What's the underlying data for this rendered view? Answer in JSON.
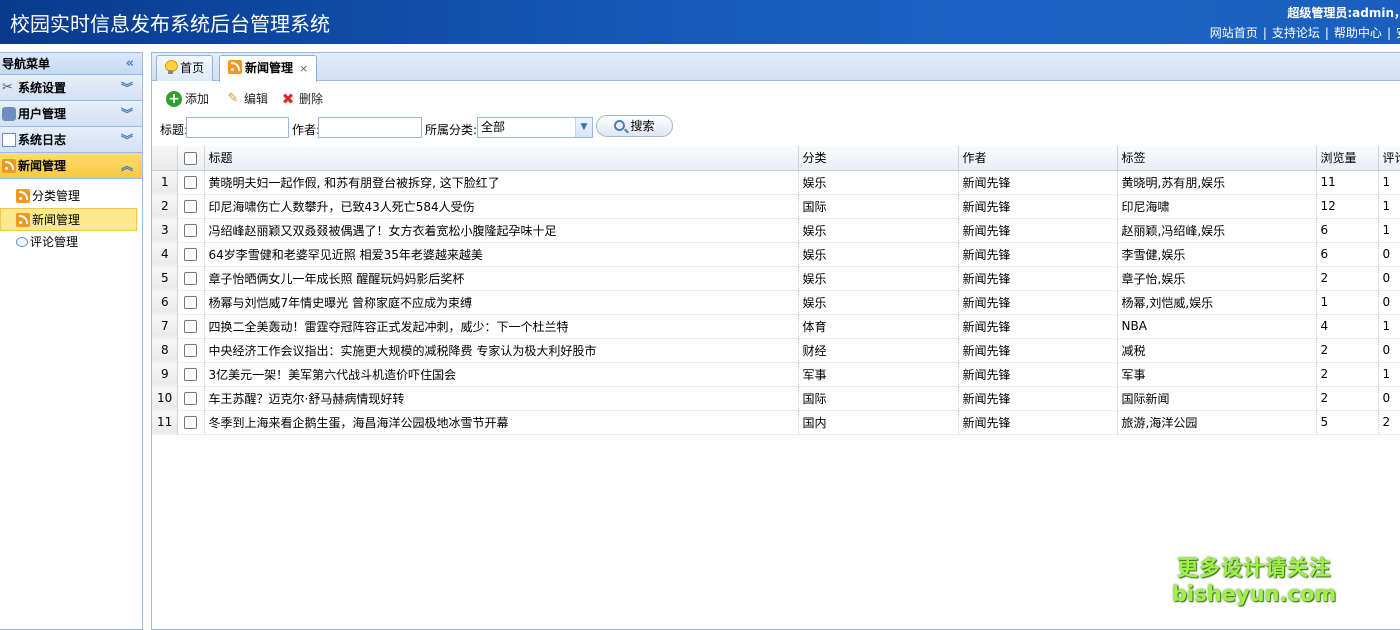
{
  "header": {
    "title": "校园实时信息发布系统后台管理系统",
    "user_text": "超级管理员:admin，",
    "links": [
      "网站首页",
      "支持论坛",
      "帮助中心",
      "安"
    ]
  },
  "sidebar": {
    "title": "导航菜单",
    "panels": [
      {
        "label": "系统设置",
        "icon": "tools-icon"
      },
      {
        "label": "用户管理",
        "icon": "users-icon"
      },
      {
        "label": "系统日志",
        "icon": "log-icon"
      },
      {
        "label": "新闻管理",
        "icon": "rss-icon"
      }
    ],
    "sub_items": [
      {
        "label": "分类管理",
        "icon": "rss-icon"
      },
      {
        "label": "新闻管理",
        "icon": "rss-icon"
      },
      {
        "label": "评论管理",
        "icon": "comment-icon"
      }
    ]
  },
  "tabs": [
    {
      "label": "首页"
    },
    {
      "label": "新闻管理",
      "close": "×"
    }
  ],
  "toolbar": {
    "add": "添加",
    "edit": "编辑",
    "delete": "删除"
  },
  "search": {
    "title_label": "标题:",
    "title_value": "",
    "author_label": "作者:",
    "author_value": "",
    "category_label": "所属分类:",
    "category_value": "全部",
    "search_button": "搜索"
  },
  "grid": {
    "columns": [
      "标题",
      "分类",
      "作者",
      "标签",
      "浏览量",
      "评论"
    ],
    "rows": [
      {
        "n": "1",
        "title": "黄晓明夫妇一起作假, 和苏有朋登台被拆穿, 这下脸红了",
        "cat": "娱乐",
        "author": "新闻先锋",
        "tags": "黄晓明,苏有朋,娱乐",
        "views": "11",
        "comments": "1"
      },
      {
        "n": "2",
        "title": "印尼海啸伤亡人数攀升，已致43人死亡584人受伤",
        "cat": "国际",
        "author": "新闻先锋",
        "tags": "印尼海啸",
        "views": "12",
        "comments": "1"
      },
      {
        "n": "3",
        "title": "冯绍峰赵丽颖又双叒叕被偶遇了！女方衣着宽松小腹隆起孕味十足",
        "cat": "娱乐",
        "author": "新闻先锋",
        "tags": "赵丽颖,冯绍峰,娱乐",
        "views": "6",
        "comments": "1"
      },
      {
        "n": "4",
        "title": "64岁李雪健和老婆罕见近照 相爱35年老婆越来越美",
        "cat": "娱乐",
        "author": "新闻先锋",
        "tags": "李雪健,娱乐",
        "views": "6",
        "comments": "0"
      },
      {
        "n": "5",
        "title": "章子怡晒俩女儿一年成长照 醒醒玩妈妈影后奖杯",
        "cat": "娱乐",
        "author": "新闻先锋",
        "tags": "章子怡,娱乐",
        "views": "2",
        "comments": "0"
      },
      {
        "n": "6",
        "title": "杨幂与刘恺威7年情史曝光 曾称家庭不应成为束缚",
        "cat": "娱乐",
        "author": "新闻先锋",
        "tags": "杨幂,刘恺威,娱乐",
        "views": "1",
        "comments": "0"
      },
      {
        "n": "7",
        "title": "四换二全美轰动！雷霆夺冠阵容正式发起冲刺，威少：下一个杜兰特",
        "cat": "体育",
        "author": "新闻先锋",
        "tags": "NBA",
        "views": "4",
        "comments": "1"
      },
      {
        "n": "8",
        "title": "中央经济工作会议指出：实施更大规模的减税降费 专家认为极大利好股市",
        "cat": "财经",
        "author": "新闻先锋",
        "tags": "减税",
        "views": "2",
        "comments": "0"
      },
      {
        "n": "9",
        "title": "3亿美元一架！美军第六代战斗机造价吓住国会",
        "cat": "军事",
        "author": "新闻先锋",
        "tags": "军事",
        "views": "2",
        "comments": "1"
      },
      {
        "n": "10",
        "title": "车王苏醒？迈克尔·舒马赫病情现好转",
        "cat": "国际",
        "author": "新闻先锋",
        "tags": "国际新闻",
        "views": "2",
        "comments": "0"
      },
      {
        "n": "11",
        "title": "冬季到上海来看企鹅生蛋，海昌海洋公园极地冰雪节开幕",
        "cat": "国内",
        "author": "新闻先锋",
        "tags": "旅游,海洋公园",
        "views": "5",
        "comments": "2"
      }
    ]
  },
  "watermark": {
    "line1": "更多设计请关注",
    "line2": "bisheyun.com"
  }
}
